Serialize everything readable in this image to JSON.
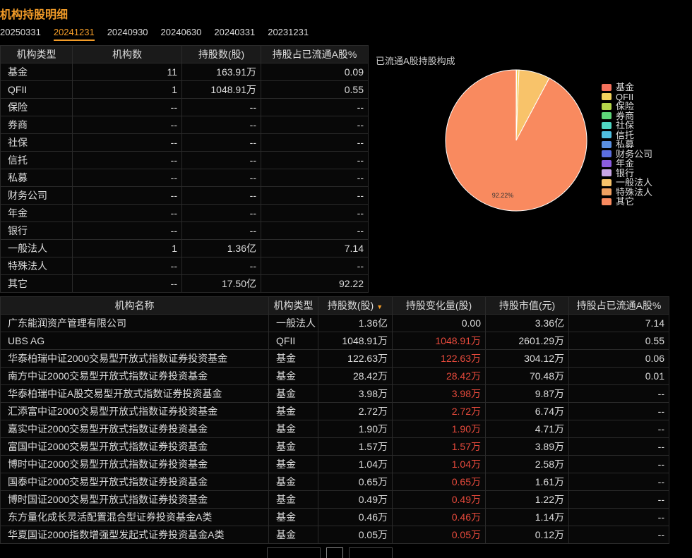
{
  "title": "机构持股明细",
  "dates": [
    "20250331",
    "20241231",
    "20240930",
    "20240630",
    "20240331",
    "20231231"
  ],
  "active_date": "20241231",
  "summary": {
    "headers": [
      "机构类型",
      "机构数",
      "持股数(股)",
      "持股占已流通A股%"
    ],
    "rows": [
      [
        "基金",
        "11",
        "163.91万",
        "0.09"
      ],
      [
        "QFII",
        "1",
        "1048.91万",
        "0.55"
      ],
      [
        "保险",
        "--",
        "--",
        "--"
      ],
      [
        "券商",
        "--",
        "--",
        "--"
      ],
      [
        "社保",
        "--",
        "--",
        "--"
      ],
      [
        "信托",
        "--",
        "--",
        "--"
      ],
      [
        "私募",
        "--",
        "--",
        "--"
      ],
      [
        "财务公司",
        "--",
        "--",
        "--"
      ],
      [
        "年金",
        "--",
        "--",
        "--"
      ],
      [
        "银行",
        "--",
        "--",
        "--"
      ],
      [
        "一般法人",
        "1",
        "1.36亿",
        "7.14"
      ],
      [
        "特殊法人",
        "--",
        "--",
        "--"
      ],
      [
        "其它",
        "--",
        "17.50亿",
        "92.22"
      ]
    ]
  },
  "pie": {
    "title": "已流通A股持股构成",
    "label": "92.22%",
    "legend": [
      {
        "name": "基金",
        "color": "#f3715c"
      },
      {
        "name": "QFII",
        "color": "#f2d25c"
      },
      {
        "name": "保险",
        "color": "#b5d64a"
      },
      {
        "name": "券商",
        "color": "#5ed67a"
      },
      {
        "name": "社保",
        "color": "#4fd6c2"
      },
      {
        "name": "信托",
        "color": "#4fbfe0"
      },
      {
        "name": "私募",
        "color": "#5a8fe0"
      },
      {
        "name": "财务公司",
        "color": "#5c6fe0"
      },
      {
        "name": "年金",
        "color": "#8a5ce0"
      },
      {
        "name": "银行",
        "color": "#c8a6e6"
      },
      {
        "name": "一般法人",
        "color": "#f8c36a"
      },
      {
        "name": "特殊法人",
        "color": "#f0a060"
      },
      {
        "name": "其它",
        "color": "#f98a5f"
      }
    ]
  },
  "chart_data": {
    "type": "pie",
    "title": "已流通A股持股构成",
    "categories": [
      "基金",
      "QFII",
      "保险",
      "券商",
      "社保",
      "信托",
      "私募",
      "财务公司",
      "年金",
      "银行",
      "一般法人",
      "特殊法人",
      "其它"
    ],
    "values": [
      0.09,
      0.55,
      0,
      0,
      0,
      0,
      0,
      0,
      0,
      0,
      7.14,
      0,
      92.22
    ],
    "colors": [
      "#f3715c",
      "#f2d25c",
      "#b5d64a",
      "#5ed67a",
      "#4fd6c2",
      "#4fbfe0",
      "#5a8fe0",
      "#5c6fe0",
      "#8a5ce0",
      "#c8a6e6",
      "#f8c36a",
      "#f0a060",
      "#f98a5f"
    ],
    "legend": "right"
  },
  "detail": {
    "headers": [
      "机构名称",
      "机构类型",
      "持股数(股)",
      "持股变化量(股)",
      "持股市值(元)",
      "持股占已流通A股%"
    ],
    "sort_icon": "sort-desc-icon",
    "rows": [
      [
        "广东能润资产管理有限公司",
        "一般法人",
        "1.36亿",
        "0.00",
        "3.36亿",
        "7.14"
      ],
      [
        "UBS AG",
        "QFII",
        "1048.91万",
        "1048.91万",
        "2601.29万",
        "0.55"
      ],
      [
        "华泰柏瑞中证2000交易型开放式指数证券投资基金",
        "基金",
        "122.63万",
        "122.63万",
        "304.12万",
        "0.06"
      ],
      [
        "南方中证2000交易型开放式指数证券投资基金",
        "基金",
        "28.42万",
        "28.42万",
        "70.48万",
        "0.01"
      ],
      [
        "华泰柏瑞中证A股交易型开放式指数证券投资基金",
        "基金",
        "3.98万",
        "3.98万",
        "9.87万",
        "--"
      ],
      [
        "汇添富中证2000交易型开放式指数证券投资基金",
        "基金",
        "2.72万",
        "2.72万",
        "6.74万",
        "--"
      ],
      [
        "嘉实中证2000交易型开放式指数证券投资基金",
        "基金",
        "1.90万",
        "1.90万",
        "4.71万",
        "--"
      ],
      [
        "富国中证2000交易型开放式指数证券投资基金",
        "基金",
        "1.57万",
        "1.57万",
        "3.89万",
        "--"
      ],
      [
        "博时中证2000交易型开放式指数证券投资基金",
        "基金",
        "1.04万",
        "1.04万",
        "2.58万",
        "--"
      ],
      [
        "国泰中证2000交易型开放式指数证券投资基金",
        "基金",
        "0.65万",
        "0.65万",
        "1.61万",
        "--"
      ],
      [
        "博时国证2000交易型开放式指数证券投资基金",
        "基金",
        "0.49万",
        "0.49万",
        "1.22万",
        "--"
      ],
      [
        "东方量化成长灵活配置混合型证券投资基金A类",
        "基金",
        "0.46万",
        "0.46万",
        "1.14万",
        "--"
      ],
      [
        "华夏国证2000指数增强型发起式证券投资基金A类",
        "基金",
        "0.05万",
        "0.05万",
        "0.12万",
        "--"
      ]
    ],
    "red_change_rows": [
      1,
      2,
      3,
      4,
      5,
      6,
      7,
      8,
      9,
      10,
      11,
      12
    ]
  }
}
